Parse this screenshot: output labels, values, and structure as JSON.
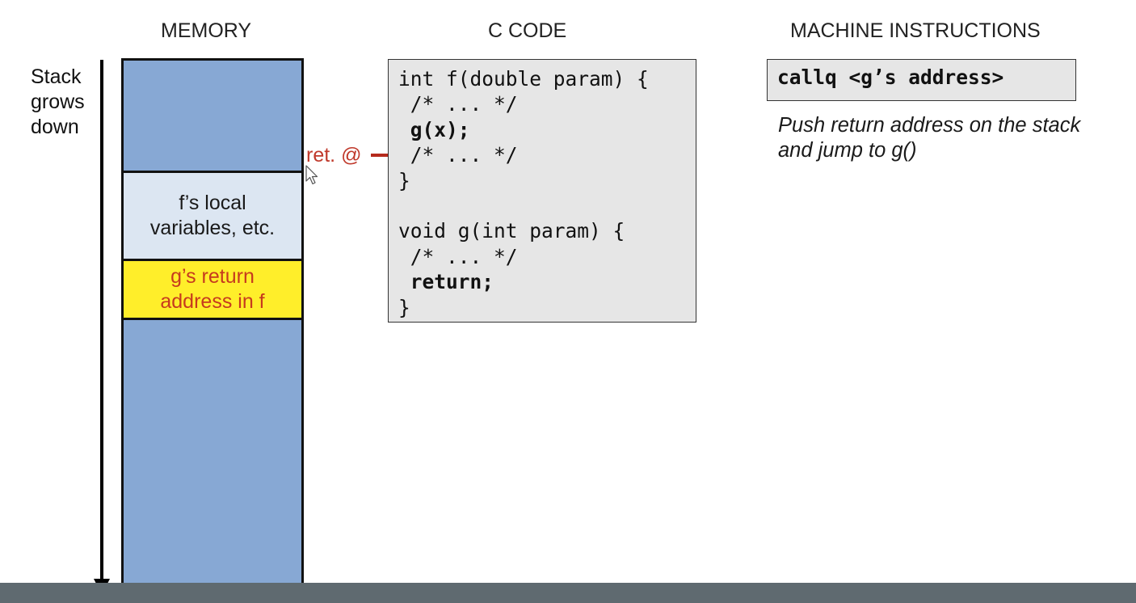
{
  "headings": {
    "memory": "MEMORY",
    "c_code": "C CODE",
    "machine": "MACHINE INSTRUCTIONS"
  },
  "stack_label": [
    "Stack",
    "grows",
    "down"
  ],
  "memory": {
    "f_locals": [
      "f’s local",
      "variables, etc."
    ],
    "g_return": [
      "g’s return",
      "address in f"
    ]
  },
  "ret_label": "ret. @",
  "code": [
    {
      "text": "int f(double param) {",
      "bold": false
    },
    {
      "text": " /* ... */",
      "bold": false
    },
    {
      "text": " g(x);",
      "bold": true
    },
    {
      "text": " /* ... */",
      "bold": false
    },
    {
      "text": "}",
      "bold": false
    },
    {
      "text": "",
      "bold": false
    },
    {
      "text": "void g(int param) {",
      "bold": false
    },
    {
      "text": " /* ... */",
      "bold": false
    },
    {
      "text": " return;",
      "bold": true
    },
    {
      "text": "}",
      "bold": false
    }
  ],
  "instruction": "callq <g’s address>",
  "instruction_desc": [
    "Push return address on the stack",
    "and jump to g()"
  ],
  "colors": {
    "stack_blue": "#87a8d4",
    "locals_light_blue": "#dce6f2",
    "return_yellow": "#ffee2a",
    "return_text_red": "#c63a1e",
    "pointer_red": "#b52a1c",
    "code_bg": "#e6e6e6"
  }
}
